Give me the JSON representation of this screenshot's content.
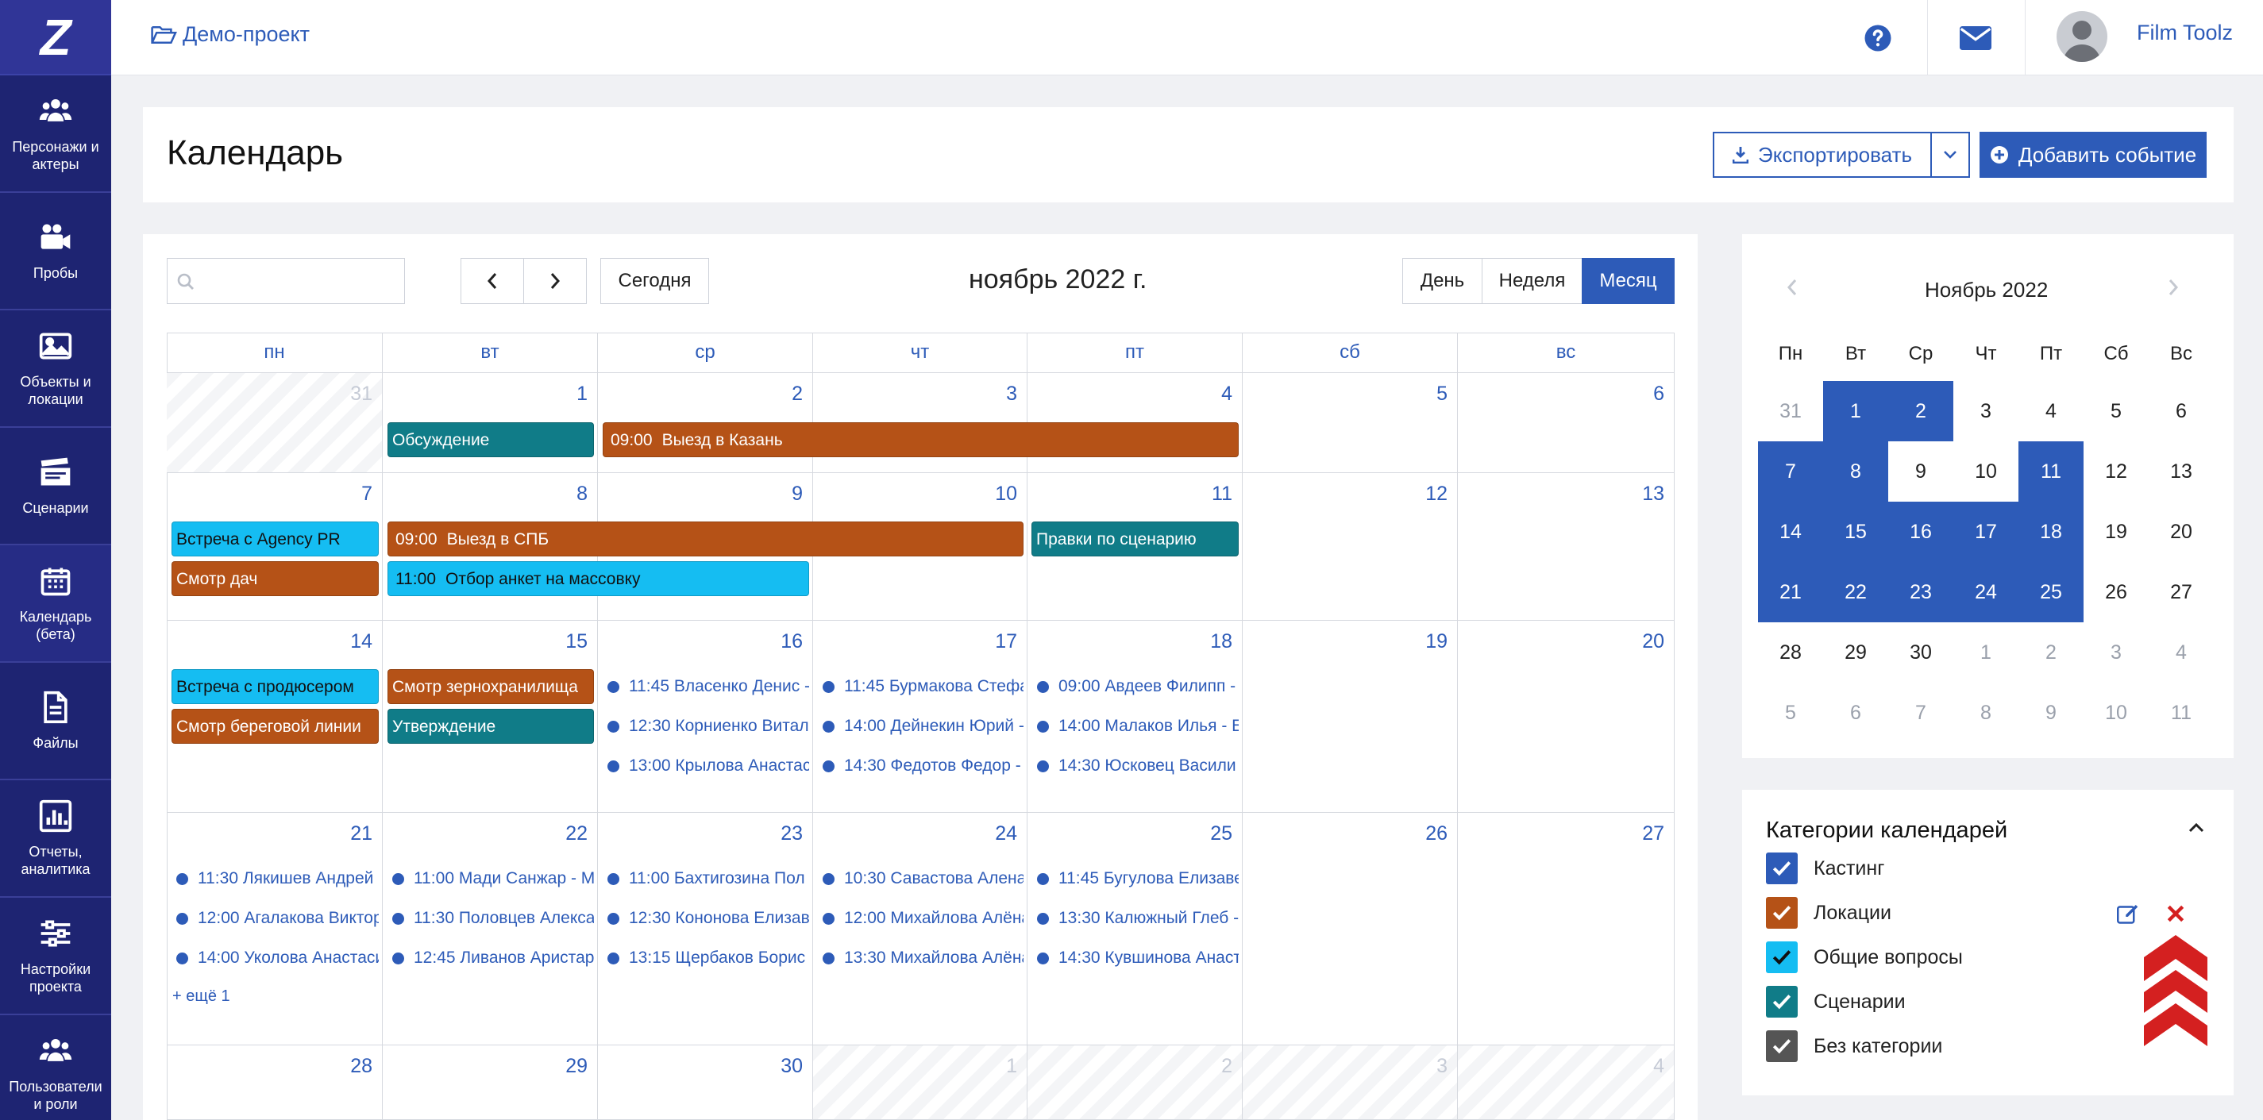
{
  "sidebar": {
    "logo": "Z",
    "items": [
      {
        "label": "Персонажи и актеры",
        "icon": "users-icon"
      },
      {
        "label": "Пробы",
        "icon": "video-camera-icon"
      },
      {
        "label": "Объекты и локации",
        "icon": "image-icon"
      },
      {
        "label": "Сценарии",
        "icon": "clapperboard-icon"
      },
      {
        "label": "Календарь (бета)",
        "icon": "calendar-icon"
      },
      {
        "label": "Файлы",
        "icon": "file-icon"
      },
      {
        "label": "Отчеты, аналитика",
        "icon": "bar-chart-icon"
      },
      {
        "label": "Настройки проекта",
        "icon": "sliders-icon"
      },
      {
        "label": "Пользователи и роли",
        "icon": "users-icon"
      }
    ]
  },
  "topbar": {
    "project": "Демо-проект",
    "user_name": "Film Toolz"
  },
  "header": {
    "title": "Календарь",
    "export_label": "Экспортировать",
    "add_event_label": "Добавить событие"
  },
  "toolbar": {
    "search_placeholder": "",
    "today_label": "Сегодня",
    "month_title": "ноябрь 2022 г.",
    "views": [
      "День",
      "Неделя",
      "Месяц"
    ],
    "active_view": "Месяц"
  },
  "calendar": {
    "weekdays": [
      "пн",
      "вт",
      "ср",
      "чт",
      "пт",
      "сб",
      "вс"
    ],
    "weeks": [
      [
        "31",
        "1",
        "2",
        "3",
        "4",
        "5",
        "6"
      ],
      [
        "7",
        "8",
        "9",
        "10",
        "11",
        "12",
        "13"
      ],
      [
        "14",
        "15",
        "16",
        "17",
        "18",
        "19",
        "20"
      ],
      [
        "21",
        "22",
        "23",
        "24",
        "25",
        "26",
        "27"
      ],
      [
        "28",
        "29",
        "30",
        "1",
        "2",
        "3",
        "4"
      ]
    ],
    "events": {
      "w0_obsuzhdenie": "Обсуждение",
      "w0_kazan_time": "09:00",
      "w0_kazan": "Выезд в Казань",
      "w1_agency": "Встреча с Agency PR",
      "w1_dach": "Смотр дач",
      "w1_spb_time": "09:00",
      "w1_spb": "Выезд в СПБ",
      "w1_otbor_time": "11:00",
      "w1_otbor": "Отбор анкет на массовку",
      "w1_pravki": "Правки по сценарию",
      "w2_producer": "Встреча с продюсером",
      "w2_bereg": "Смотр береговой линии",
      "w2_zerno": "Смотр зернохранилища",
      "w2_utverzhdenie": "Утверждение",
      "d16": [
        "11:45 Власенко Денис -",
        "12:30 Корниенко Витал",
        "13:00 Крылова Анастас"
      ],
      "d17": [
        "11:45 Бурмакова Стефа",
        "14:00 Дейнекин Юрий -",
        "14:30 Федотов Федор -"
      ],
      "d18": [
        "09:00 Авдеев Филипп -",
        "14:00 Малаков Илья - Е",
        "14:30 Юсковец Васили"
      ],
      "d21": [
        "11:30 Лякишев Андрей",
        "12:00 Агалакова Виктор",
        "14:00 Уколова Анастаси"
      ],
      "d21_more": "+ ещё 1",
      "d22": [
        "11:00 Мади Санжар - М",
        "11:30 Половцев Алекса",
        "12:45 Ливанов Аристар"
      ],
      "d23": [
        "11:00 Бахтигозина Пол",
        "12:30 Кононова Елизав",
        "13:15 Щербаков Борис"
      ],
      "d24": [
        "10:30 Савастова Алена",
        "12:00 Михайлова Алёна",
        "13:30 Михайлова Алёна"
      ],
      "d25": [
        "11:45 Бугулова Елизаве",
        "13:30 Калюжный Глеб -",
        "14:30 Кувшинова Анаст"
      ]
    }
  },
  "mini_calendar": {
    "month": "Ноябрь 2022",
    "weekdays": [
      "Пн",
      "Вт",
      "Ср",
      "Чт",
      "Пт",
      "Сб",
      "Вс"
    ],
    "weeks": [
      [
        "31",
        "1",
        "2",
        "3",
        "4",
        "5",
        "6"
      ],
      [
        "7",
        "8",
        "9",
        "10",
        "11",
        "12",
        "13"
      ],
      [
        "14",
        "15",
        "16",
        "17",
        "18",
        "19",
        "20"
      ],
      [
        "21",
        "22",
        "23",
        "24",
        "25",
        "26",
        "27"
      ],
      [
        "28",
        "29",
        "30",
        "1",
        "2",
        "3",
        "4"
      ],
      [
        "5",
        "6",
        "7",
        "8",
        "9",
        "10",
        "11"
      ]
    ]
  },
  "categories": {
    "title": "Категории календарей",
    "items": [
      {
        "label": "Кастинг",
        "color": "#2d5bb8"
      },
      {
        "label": "Локации",
        "color": "#b55217"
      },
      {
        "label": "Общие вопросы",
        "color": "#15bdf2"
      },
      {
        "label": "Сценарии",
        "color": "#107c88"
      },
      {
        "label": "Без категории",
        "color": "#555555"
      }
    ]
  },
  "colors": {
    "sidebar": "#1e2472",
    "accent": "#2d5bb8",
    "locations": "#b55217",
    "scripts": "#107c88",
    "general": "#15bdf2",
    "scroll_top": "#d42020"
  }
}
